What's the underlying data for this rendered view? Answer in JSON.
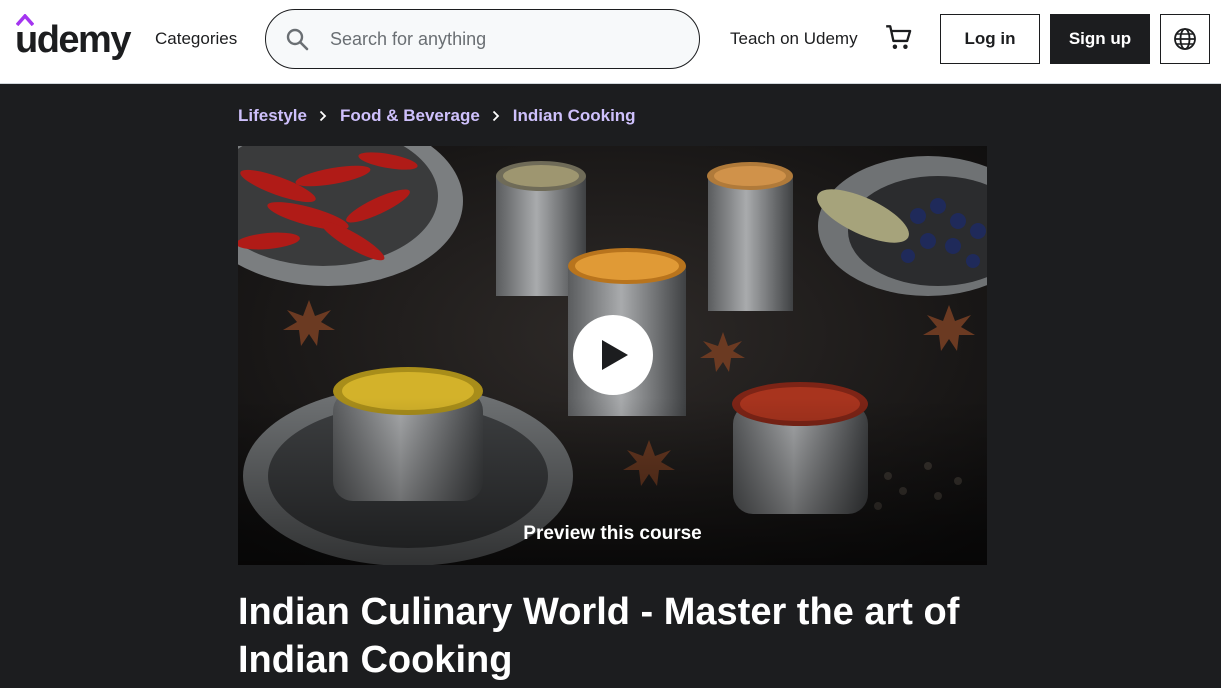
{
  "header": {
    "logo_text": "udemy",
    "categories_label": "Categories",
    "search": {
      "placeholder": "Search for anything",
      "value": ""
    },
    "teach_label": "Teach on Udemy",
    "login_label": "Log in",
    "signup_label": "Sign up",
    "icons": [
      "search-icon",
      "cart-icon",
      "globe-icon"
    ]
  },
  "breadcrumb": [
    "Lifestyle",
    "Food & Beverage",
    "Indian Cooking"
  ],
  "preview": {
    "label": "Preview this course"
  },
  "course": {
    "title": "Indian Culinary World - Master the art of Indian Cooking"
  },
  "colors": {
    "brand_purple": "#a435f0",
    "dark_bg": "#1c1d1f",
    "breadcrumb": "#cec0fc"
  }
}
